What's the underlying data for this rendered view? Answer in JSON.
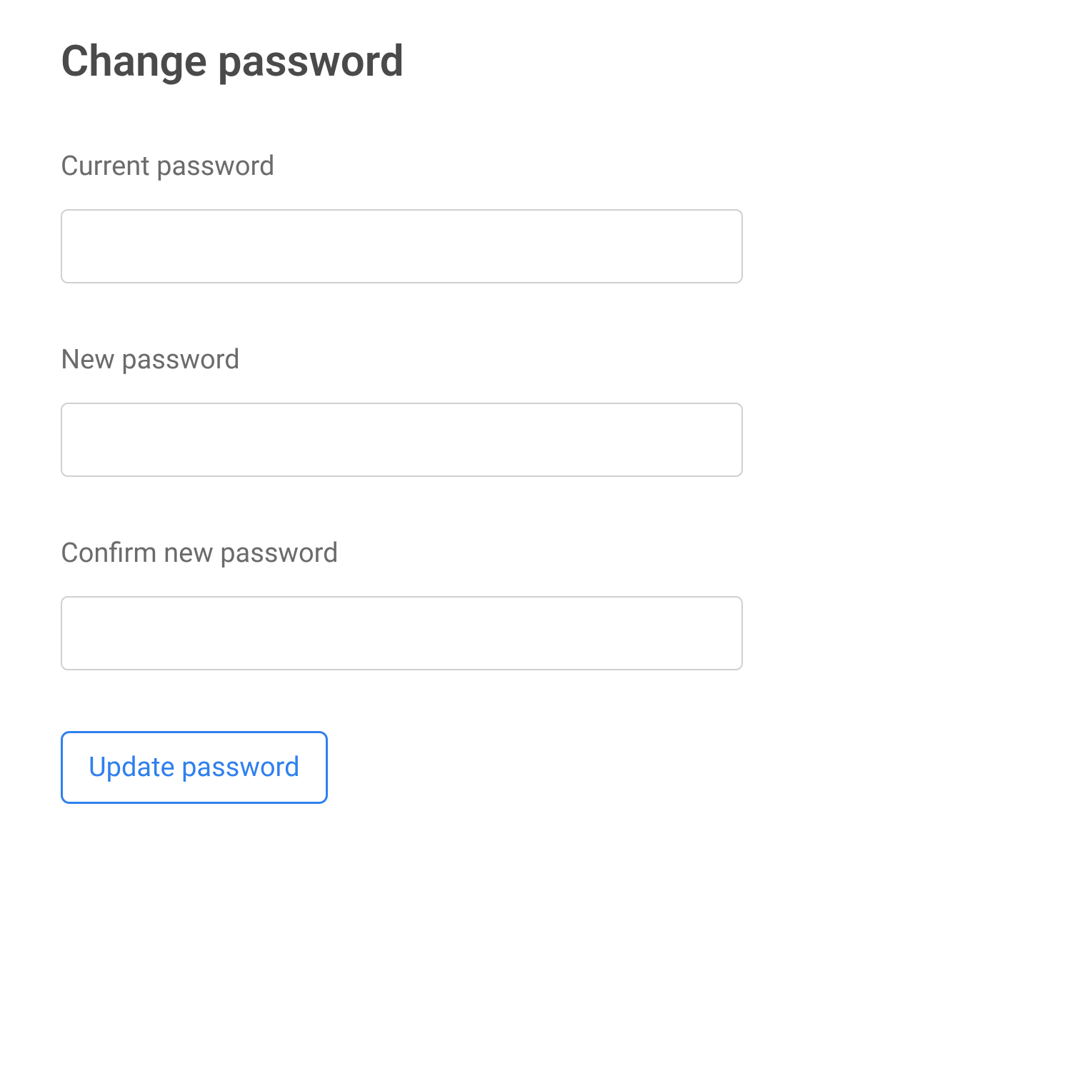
{
  "page": {
    "title": "Change password"
  },
  "form": {
    "fields": {
      "current_password": {
        "label": "Current password",
        "value": ""
      },
      "new_password": {
        "label": "New password",
        "value": ""
      },
      "confirm_password": {
        "label": "Confirm new password",
        "value": ""
      }
    },
    "submit_label": "Update password"
  }
}
